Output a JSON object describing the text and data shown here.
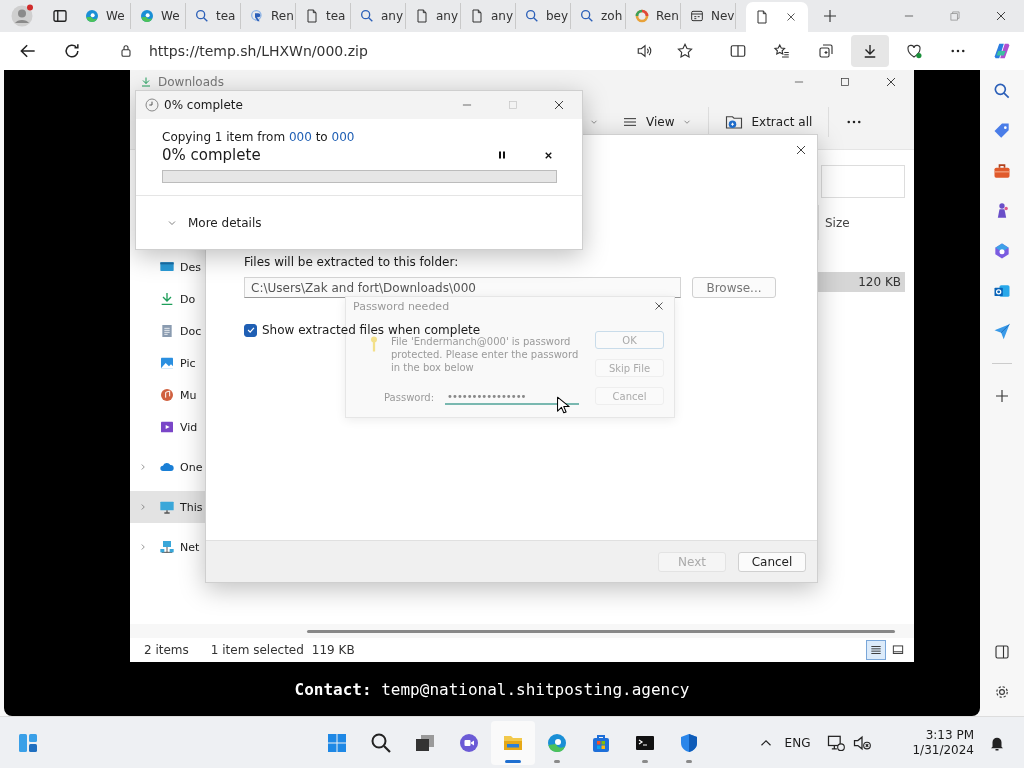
{
  "browser": {
    "tabs": [
      {
        "kind": "edge",
        "label": "We",
        "selected": false
      },
      {
        "kind": "edge",
        "label": "We",
        "selected": false
      },
      {
        "kind": "search",
        "label": "tea",
        "selected": false
      },
      {
        "kind": "app",
        "label": "Ren",
        "selected": false
      },
      {
        "kind": "page",
        "label": "tea",
        "selected": false
      },
      {
        "kind": "search",
        "label": "any",
        "selected": false
      },
      {
        "kind": "page",
        "label": "any",
        "selected": false
      },
      {
        "kind": "page",
        "label": "any",
        "selected": false
      },
      {
        "kind": "search",
        "label": "bey",
        "selected": false
      },
      {
        "kind": "search",
        "label": "zoh",
        "selected": false
      },
      {
        "kind": "ring",
        "label": "Ren",
        "selected": false
      },
      {
        "kind": "window",
        "label": "Nev",
        "selected": false
      },
      {
        "kind": "page",
        "selected": true
      }
    ],
    "url": "https://temp.sh/LHXWn/000.zip"
  },
  "explorer": {
    "title": "Downloads",
    "view": "View",
    "extract": "Extract all",
    "quick_access": [
      {
        "kind": "desktop",
        "label": "Des"
      },
      {
        "kind": "downloads",
        "label": "Do"
      },
      {
        "kind": "documents",
        "label": "Doc"
      },
      {
        "kind": "pictures",
        "label": "Pic"
      },
      {
        "kind": "music",
        "label": "Mu"
      },
      {
        "kind": "videos",
        "label": "Vid"
      }
    ],
    "locations": [
      {
        "kind": "cloud",
        "label": "One",
        "expanded": false,
        "selected": false
      },
      {
        "kind": "pc",
        "label": "This",
        "expanded": false,
        "selected": true
      },
      {
        "kind": "network",
        "label": "Net",
        "expanded": false,
        "selected": false
      }
    ],
    "column": "Size",
    "file": {
      "size": "120 KB",
      "selected": true
    },
    "status": {
      "items": "2 items",
      "selection": "1 item selected",
      "size": "119 KB"
    },
    "view_modes": [
      {
        "kind": "details",
        "selected": true
      },
      {
        "kind": "tiles",
        "selected": false
      }
    ]
  },
  "extract_dialog": {
    "folder_label": "Files will be extracted to this folder:",
    "path": "C:\\Users\\Zak and fort\\Downloads\\000",
    "browse": "Browse...",
    "show_files": {
      "label": "Show extracted files when complete",
      "checked": true
    },
    "buttons": [
      {
        "label": "Next",
        "disabled": true
      },
      {
        "label": "Cancel",
        "disabled": false
      }
    ]
  },
  "password_dialog": {
    "title": "Password needed",
    "message": "File 'Endermanch@000' is password protected.  Please enter the password in the box below",
    "label": "Password:",
    "value": "••••••••••••••••",
    "buttons": [
      {
        "label": "OK",
        "default": true
      },
      {
        "label": "Skip File",
        "default": false
      },
      {
        "label": "Cancel",
        "default": false
      }
    ]
  },
  "copy_dialog": {
    "title": "0% complete",
    "prefix": "Copying 1 item from",
    "source": "000",
    "joiner": "to",
    "destination": "000",
    "status": "0% complete",
    "level": 0,
    "details": "More details",
    "details_expanded": false
  },
  "banner": "**Contact:** temp@national.shitposting.agency",
  "edge_sidebar": {
    "apps": [
      {
        "kind": "search"
      },
      {
        "kind": "tag"
      },
      {
        "kind": "briefcase"
      },
      {
        "kind": "chess"
      },
      {
        "kind": "hexagon"
      },
      {
        "kind": "mail"
      },
      {
        "kind": "send"
      }
    ]
  },
  "taskbar": {
    "apps": [
      {
        "kind": "start",
        "selected": false,
        "running": false
      },
      {
        "kind": "search",
        "selected": false,
        "running": false
      },
      {
        "kind": "taskview",
        "selected": false,
        "running": false
      },
      {
        "kind": "chat",
        "selected": false,
        "running": false
      },
      {
        "kind": "folder",
        "selected": true,
        "running": true
      },
      {
        "kind": "edge",
        "selected": false,
        "running": true
      },
      {
        "kind": "store",
        "selected": false,
        "running": false
      },
      {
        "kind": "terminal",
        "selected": false,
        "running": true
      },
      {
        "kind": "shield",
        "selected": false,
        "running": true
      }
    ],
    "language": "ENG",
    "time": "3:13 PM",
    "date": "1/31/2024"
  }
}
